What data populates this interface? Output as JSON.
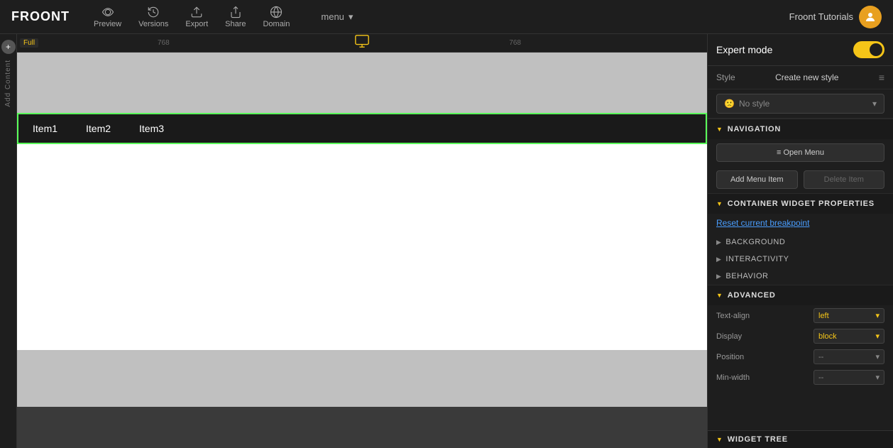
{
  "app": {
    "logo": "FROONT"
  },
  "navbar": {
    "preview_label": "Preview",
    "versions_label": "Versions",
    "export_label": "Export",
    "share_label": "Share",
    "domain_label": "Domain",
    "menu_label": "menu",
    "user_name": "Froont Tutorials"
  },
  "left_sidebar": {
    "add_content_label": "Add Content",
    "plus_label": "+"
  },
  "ruler": {
    "full_label": "Full",
    "marker_768_left": "768",
    "marker_768_right": "768"
  },
  "canvas": {
    "nav_items": [
      "Item1",
      "Item2",
      "Item3"
    ]
  },
  "right_panel": {
    "expert_mode_label": "Expert mode",
    "style_label": "Style",
    "create_new_style_label": "Create new style",
    "no_style_label": "No style",
    "navigation_section": "NAVIGATION",
    "open_menu_label": "≡  Open Menu",
    "add_menu_item_label": "Add Menu Item",
    "delete_item_label": "Delete Item",
    "container_widget_props_label": "CONTAINER WIDGET PROPERTIES",
    "reset_breakpoint_label": "Reset current breakpoint",
    "background_label": "BACKGROUND",
    "interactivity_label": "INTERACTIVITY",
    "behavior_label": "BEHAVIOR",
    "advanced_label": "ADVANCED",
    "text_align_label": "Text-align",
    "text_align_value": "left",
    "display_label": "Display",
    "display_value": "block",
    "position_label": "Position",
    "position_value": "--",
    "min_width_label": "Min-width",
    "min_width_value": "--",
    "widget_tree_label": "WIDGET TREE"
  }
}
